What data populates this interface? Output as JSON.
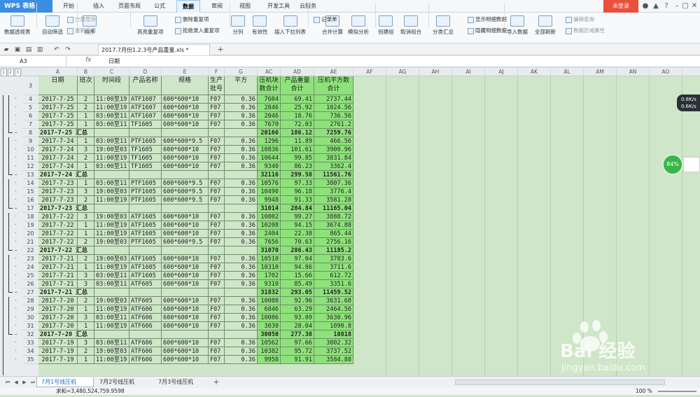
{
  "app": {
    "logo": "WPS 表格",
    "login": "未登录"
  },
  "menu": [
    "开始",
    "插入",
    "页面布局",
    "公式",
    "数据",
    "审阅",
    "视图",
    "开发工具",
    "云服务"
  ],
  "menu_active": "数据",
  "ribbon": {
    "big": [
      "数据透视表",
      "自动筛选",
      "排序",
      "高亮重复项",
      "分列",
      "有效性",
      "插入下拉列表",
      "合并计算",
      "模拟分析",
      "创建组",
      "取消组合",
      "分类汇总",
      "导入数据",
      "全部刷新"
    ],
    "small": [
      "全部显示",
      "重新应用",
      "删除重复项",
      "拒绝录入重复项",
      "记录单",
      "显示明细数据",
      "隐藏明细数据",
      "编辑查询",
      "数据区域属性"
    ]
  },
  "doc": {
    "tab": "2017.7月份1.2.3号产品重量.xls *"
  },
  "formula": {
    "namebox": "A3",
    "fx": "fx",
    "content": "日期"
  },
  "columns": [
    "A",
    "B",
    "C",
    "D",
    "E",
    "F",
    "G",
    "AC",
    "AD",
    "AE",
    "AF",
    "AG",
    "AH",
    "AI",
    "AJ",
    "AK",
    "AL",
    "AM",
    "AN",
    "AO"
  ],
  "outline_levels": [
    "1",
    "2",
    "3"
  ],
  "header": {
    "row": "3",
    "cells": [
      "日期",
      "班次",
      "时间段",
      "产品名称",
      "规格",
      "生产批号",
      "平方",
      "压机块数合计",
      "产品重量合计",
      "压机平方数合计"
    ]
  },
  "rows": [
    {
      "n": "4",
      "type": "d",
      "v": [
        "2017-7-25",
        "2",
        "11:00至19",
        "ATF1607",
        "600*600*10",
        "F07",
        "0.36",
        "7604",
        "69.41",
        "2737.44"
      ]
    },
    {
      "n": "5",
      "type": "d",
      "v": [
        "2017-7-25",
        "2",
        "11:00至19",
        "ATF1607",
        "600*600*10",
        "F07",
        "0.36",
        "2846",
        "25.92",
        "1024.56"
      ]
    },
    {
      "n": "6",
      "type": "d",
      "v": [
        "2017-7-25",
        "1",
        "03:00至11",
        "ATF1607",
        "600*600*10",
        "F07",
        "0.36",
        "2046",
        "18.76",
        "736.56"
      ]
    },
    {
      "n": "7",
      "type": "d",
      "v": [
        "2017-7-25",
        "1",
        "03:00至11",
        "TF1605",
        "600*600*10",
        "F07",
        "0.36",
        "7670",
        "72.03",
        "2761.2"
      ]
    },
    {
      "n": "8",
      "type": "s",
      "v": [
        "2017-7-25 汇总",
        "",
        "",
        "",
        "",
        "",
        "",
        "20166",
        "186.12",
        "7259.76"
      ]
    },
    {
      "n": "9",
      "type": "d",
      "v": [
        "2017-7-24",
        "1",
        "03:00至11",
        "PTF1605",
        "600*600*9.5",
        "F07",
        "0.36",
        "1296",
        "11.89",
        "466.56"
      ]
    },
    {
      "n": "10",
      "type": "d",
      "v": [
        "2017-7-24",
        "3",
        "19:00至03",
        "TF1605",
        "600*600*10",
        "F07",
        "0.36",
        "10836",
        "101.61",
        "3900.96"
      ]
    },
    {
      "n": "11",
      "type": "d",
      "v": [
        "2017-7-24",
        "2",
        "11:00至19",
        "TF1605",
        "600*600*10",
        "F07",
        "0.36",
        "10644",
        "99.85",
        "3831.84"
      ]
    },
    {
      "n": "12",
      "type": "d",
      "v": [
        "2017-7-24",
        "1",
        "03:00至11",
        "TF1605",
        "600*600*10",
        "F07",
        "0.36",
        "9340",
        "86.23",
        "3362.4"
      ]
    },
    {
      "n": "13",
      "type": "s",
      "v": [
        "2017-7-24 汇总",
        "",
        "",
        "",
        "",
        "",
        "",
        "32116",
        "299.58",
        "11561.76"
      ]
    },
    {
      "n": "14",
      "type": "d",
      "v": [
        "2017-7-23",
        "1",
        "03:00至11",
        "PTF1605",
        "600*600*9.5",
        "F07",
        "0.36",
        "10576",
        "97.33",
        "3807.36"
      ]
    },
    {
      "n": "15",
      "type": "d",
      "v": [
        "2017-7-23",
        "3",
        "19:00至03",
        "PTF1605",
        "600*600*9.5",
        "F07",
        "0.36",
        "10490",
        "96.18",
        "3776.4"
      ]
    },
    {
      "n": "16",
      "type": "d",
      "v": [
        "2017-7-23",
        "2",
        "11:00至19",
        "PTF1605",
        "600*600*9.5",
        "F07",
        "0.36",
        "9948",
        "91.33",
        "3581.28"
      ]
    },
    {
      "n": "17",
      "type": "s",
      "v": [
        "2017-7-23 汇总",
        "",
        "",
        "",
        "",
        "",
        "",
        "31014",
        "284.84",
        "11165.04"
      ]
    },
    {
      "n": "18",
      "type": "d",
      "v": [
        "2017-7-22",
        "3",
        "19:00至03",
        "ATF1605",
        "600*600*10",
        "F07",
        "0.36",
        "10802",
        "99.27",
        "3888.72"
      ]
    },
    {
      "n": "19",
      "type": "d",
      "v": [
        "2017-7-22",
        "1",
        "11:00至19",
        "ATF1605",
        "600*600*10",
        "F07",
        "0.36",
        "10208",
        "94.15",
        "3674.88"
      ]
    },
    {
      "n": "20",
      "type": "d",
      "v": [
        "2017-7-22",
        "1",
        "11:00至19",
        "ATF1605",
        "600*600*10",
        "F07",
        "0.36",
        "2404",
        "22.38",
        "865.44"
      ]
    },
    {
      "n": "21",
      "type": "d",
      "v": [
        "2017-7-22",
        "2",
        "19:00至03",
        "PTF1605",
        "600*600*9.5",
        "F07",
        "0.36",
        "7656",
        "70.63",
        "2756.16"
      ]
    },
    {
      "n": "22",
      "type": "s",
      "v": [
        "2017-7-22 汇总",
        "",
        "",
        "",
        "",
        "",
        "",
        "31070",
        "286.43",
        "11185.2"
      ]
    },
    {
      "n": "23",
      "type": "d",
      "v": [
        "2017-7-21",
        "2",
        "19:00至03",
        "ATF1605",
        "600*600*10",
        "F07",
        "0.36",
        "10510",
        "97.04",
        "3783.6"
      ]
    },
    {
      "n": "24",
      "type": "d",
      "v": [
        "2017-7-21",
        "1",
        "11:00至19",
        "ATF1605",
        "600*600*10",
        "F07",
        "0.36",
        "10310",
        "94.86",
        "3711.6"
      ]
    },
    {
      "n": "25",
      "type": "d",
      "v": [
        "2017-7-21",
        "3",
        "03:00至11",
        "ATF1605",
        "600*600*10",
        "F07",
        "0.36",
        "1702",
        "15.66",
        "612.72"
      ]
    },
    {
      "n": "26",
      "type": "d",
      "v": [
        "2017-7-21",
        "3",
        "03:00至11",
        "ATF605",
        "600*600*10",
        "F07",
        "0.36",
        "9310",
        "85.49",
        "3351.6"
      ]
    },
    {
      "n": "27",
      "type": "s",
      "v": [
        "2017-7-21 汇总",
        "",
        "",
        "",
        "",
        "",
        "",
        "31832",
        "293.05",
        "11459.52"
      ]
    },
    {
      "n": "28",
      "type": "d",
      "v": [
        "2017-7-20",
        "2",
        "19:00至03",
        "ATF605",
        "600*600*10",
        "F07",
        "0.36",
        "10088",
        "92.96",
        "3631.68"
      ]
    },
    {
      "n": "29",
      "type": "d",
      "v": [
        "2017-7-20",
        "1",
        "11:00至19",
        "ATF606",
        "600*600*10",
        "F07",
        "0.36",
        "6846",
        "63.29",
        "2464.56"
      ]
    },
    {
      "n": "30",
      "type": "d",
      "v": [
        "2017-7-20",
        "3",
        "03:00至11",
        "ATF606",
        "600*600*10",
        "F07",
        "0.36",
        "10086",
        "93.09",
        "3630.96"
      ]
    },
    {
      "n": "31",
      "type": "d",
      "v": [
        "2017-7-20",
        "1",
        "11:00至19",
        "ATF606",
        "600*600*10",
        "F07",
        "0.36",
        "3030",
        "28.04",
        "1090.8"
      ]
    },
    {
      "n": "32",
      "type": "s",
      "v": [
        "2017-7-20 汇总",
        "",
        "",
        "",
        "",
        "",
        "",
        "30050",
        "277.38",
        "10818"
      ]
    },
    {
      "n": "33",
      "type": "d",
      "v": [
        "2017-7-19",
        "3",
        "03:00至11",
        "ATF606",
        "600*600*10",
        "F07",
        "0.36",
        "10562",
        "97.66",
        "3802.32"
      ]
    },
    {
      "n": "34",
      "type": "d",
      "v": [
        "2017-7-19",
        "2",
        "19:00至03",
        "ATF606",
        "600*600*10",
        "F07",
        "0.36",
        "10382",
        "95.72",
        "3737.52"
      ]
    },
    {
      "n": "35",
      "type": "d",
      "v": [
        "2017-7-19",
        "1",
        "11:00至19",
        "ATF606",
        "600*600*10",
        "F07",
        "0.36",
        "9958",
        "91.91",
        "3584.88"
      ]
    }
  ],
  "sheets": [
    "7月1号线压机（刘）",
    "7月2号线压机（刘）",
    "7月3号线压机（刘）"
  ],
  "status": {
    "sum": "求和=3,480,524,759.9598",
    "zoom": "100 %"
  },
  "widgets": {
    "speed_up": "0.8K/s",
    "speed_down": "0.6K/s",
    "ball": "84%"
  },
  "watermark": {
    "text": "Bai 经验",
    "url": "jingyan.baidu.com"
  },
  "colors": {
    "accent": "#3b8de0",
    "login": "#e94f3c",
    "highlight": "#8ee27a",
    "sheet_bg": "#cfe6c8"
  }
}
